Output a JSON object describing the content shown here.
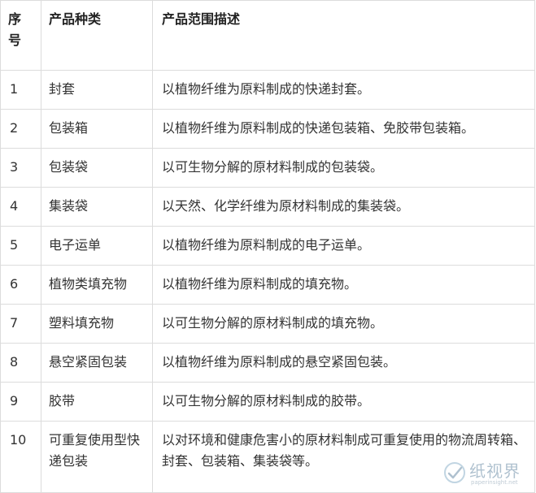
{
  "table": {
    "headers": [
      "序号",
      "产品种类",
      "产品范围描述"
    ],
    "rows": [
      {
        "no": "1",
        "category": "封套",
        "description": "以植物纤维为原料制成的快递封套。"
      },
      {
        "no": "2",
        "category": "包装箱",
        "description": "以植物纤维为原料制成的快递包装箱、免胶带包装箱。"
      },
      {
        "no": "3",
        "category": "包装袋",
        "description": "以可生物分解的原材料制成的包装袋。"
      },
      {
        "no": "4",
        "category": "集装袋",
        "description": "以天然、化学纤维为原材料制成的集装袋。"
      },
      {
        "no": "5",
        "category": "电子运单",
        "description": "以植物纤维为原料制成的电子运单。"
      },
      {
        "no": "6",
        "category": "植物类填充物",
        "description": "以植物纤维为原料制成的填充物。"
      },
      {
        "no": "7",
        "category": "塑料填充物",
        "description": "以可生物分解的原材料制成的填充物。"
      },
      {
        "no": "8",
        "category": "悬空紧固包装",
        "description": "以植物纤维为原料制成的悬空紧固包装。"
      },
      {
        "no": "9",
        "category": "胶带",
        "description": "以可生物分解的原材料制成的胶带。"
      },
      {
        "no": "10",
        "category": "可重复使用型快递包装",
        "description": "以对环境和健康危害小的原材料制成可重复使用的物流周转箱、封套、包装箱、集装袋等。"
      }
    ]
  },
  "watermark": {
    "text": "纸视界",
    "url": "paperinsight.net",
    "icon": "logo-icon",
    "color": "#6e8fa8"
  }
}
